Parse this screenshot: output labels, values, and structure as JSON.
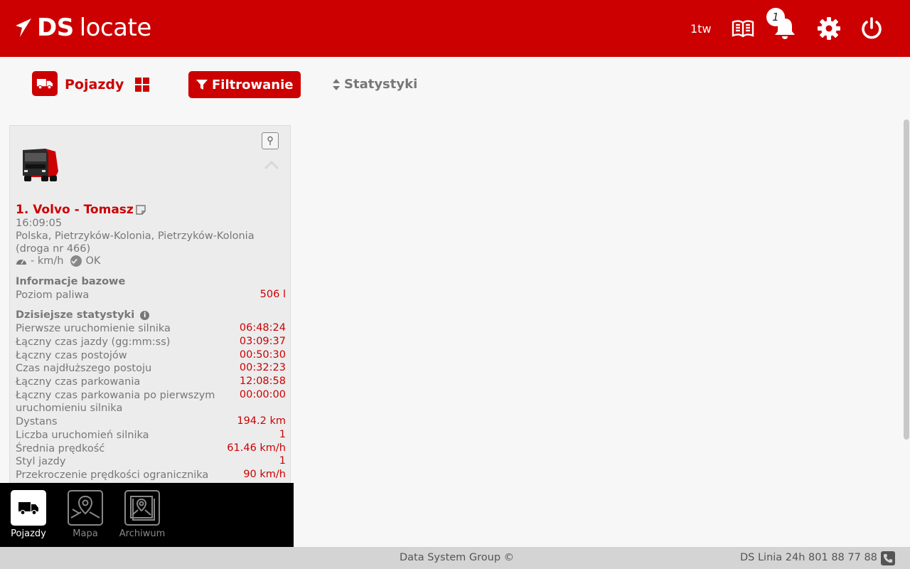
{
  "header": {
    "logo_bold": "DS",
    "logo_light": "locate",
    "user": "1tw",
    "notification_count": "1",
    "bg_color": "#cc0000"
  },
  "tabs": {
    "vehicles_label": "Pojazdy",
    "filter_label": "Filtrowanie",
    "stats_label": "Statystyki"
  },
  "vehicle": {
    "title": "1. Volvo - Tomasz",
    "time": "16:09:05",
    "address": "Polska, Pietrzyków-Kolonia, Pietrzyków-Kolonia (droga nr 466)",
    "speed": "- km/h",
    "status": "OK",
    "base_info_heading": "Informacje bazowe",
    "base_info": [
      {
        "label": "Poziom paliwa",
        "value": "506 l"
      }
    ],
    "today_heading": "Dzisiejsze statystyki",
    "today_stats": [
      {
        "label": "Pierwsze uruchomienie silnika",
        "value": "06:48:24"
      },
      {
        "label": "Łączny czas jazdy (gg:mm:ss)",
        "value": "03:09:37"
      },
      {
        "label": "Łączny czas postojów",
        "value": "00:50:30"
      },
      {
        "label": "Czas najdłuższego postoju",
        "value": "00:32:23"
      },
      {
        "label": "Łączny czas parkowania",
        "value": "12:08:58"
      },
      {
        "label": "Łączny czas parkowania po pierwszym uruchomieniu silnika",
        "value": "00:00:00"
      },
      {
        "label": "Dystans",
        "value": "194.2 km"
      },
      {
        "label": "Liczba uruchomień silnika",
        "value": "1"
      },
      {
        "label": "Średnia prędkość",
        "value": "61.46 km/h"
      },
      {
        "label": "Styl jazdy",
        "value": "1"
      },
      {
        "label": "Przekroczenie prędkości ogranicznika",
        "value": "90 km/h"
      }
    ]
  },
  "bottom_nav": [
    {
      "label": "Pojazdy",
      "icon": "truck-icon",
      "active": true
    },
    {
      "label": "Mapa",
      "icon": "map-icon",
      "active": false
    },
    {
      "label": "Archiwum",
      "icon": "archive-icon",
      "active": false
    }
  ],
  "footer": {
    "copyright": "Data System Group ©",
    "hotline": "DS Linia 24h 801 88 77 88"
  }
}
